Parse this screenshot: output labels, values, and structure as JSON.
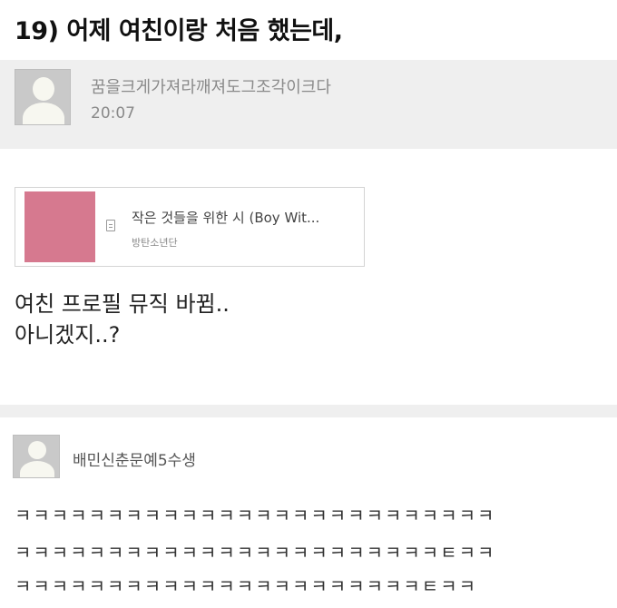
{
  "post": {
    "title": "19) 어제 여친이랑 처음 했는데,",
    "author": "꿈을크게가져라깨져도그조각이크다",
    "time": "20:07",
    "body_lines": [
      "여친 프로필 뮤직 바뀜..",
      "아니겠지..?"
    ]
  },
  "music": {
    "song_title": "작은 것들을 위한 시 (Boy Wit...",
    "artist": "방탄소년단",
    "icon": "document-icon",
    "album_color": "#d6798f"
  },
  "comment": {
    "author": "배민신춘문예5수생",
    "lines": [
      "ㅋㅋㅋㅋㅋㅋㅋㅋㅋㅋㅋㅋㅋㅋㅋㅋㅋㅋㅋㅋㅋㅋㅋㅋㅋㅋ",
      "ㅋㅋㅋㅋㅋㅋㅋㅋㅋㅋㅋㅋㅋㅋㅋㅋㅋㅋㅋㅋㅋㅋㅋㅌㅋㅋ",
      "ㅋㅋㅋㅋㅋㅋㅋㅋㅋㅋㅋㅋㅋㅋㅋㅋㅋㅋㅋㅋㅋㅋㅌㅋㅋ"
    ]
  },
  "colors": {
    "header_band": "#efefef",
    "avatar_bg": "#c9c9c9"
  }
}
